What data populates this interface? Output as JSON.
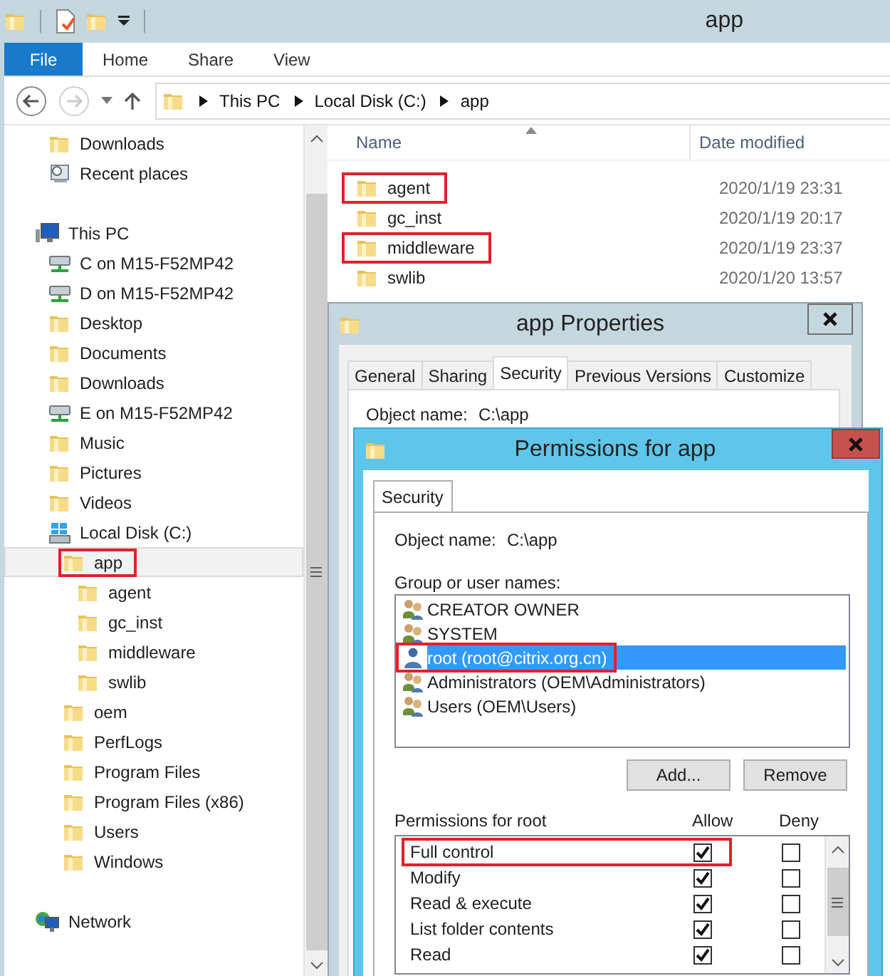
{
  "window": {
    "title": "app"
  },
  "ribbon_tabs": [
    {
      "label": "File",
      "kind": "file"
    },
    {
      "label": "Home",
      "kind": "tab"
    },
    {
      "label": "Share",
      "kind": "tab"
    },
    {
      "label": "View",
      "kind": "tab"
    }
  ],
  "address_bar": {
    "path": [
      "This PC",
      "Local Disk (C:)",
      "app"
    ]
  },
  "sidebar": {
    "items": [
      {
        "children": [
          {
            "label": "Downloads",
            "kind": "folder",
            "selected": false,
            "highlighted": false
          },
          {
            "label": "Recent places",
            "kind": "recent",
            "selected": false,
            "highlighted": false
          }
        ]
      },
      {
        "label": "This PC",
        "kind": "computer",
        "selected": false,
        "highlighted": false,
        "children": [
          {
            "label": "C on M15-F52MP42",
            "kind": "drive",
            "selected": false,
            "highlighted": false
          },
          {
            "label": "D on M15-F52MP42",
            "kind": "drive",
            "selected": false,
            "highlighted": false
          },
          {
            "label": "Desktop",
            "kind": "folder",
            "selected": false,
            "highlighted": false
          },
          {
            "label": "Documents",
            "kind": "folder",
            "selected": false,
            "highlighted": false
          },
          {
            "label": "Downloads",
            "kind": "folder",
            "selected": false,
            "highlighted": false
          },
          {
            "label": "E on M15-F52MP42",
            "kind": "drive",
            "selected": false,
            "highlighted": false
          },
          {
            "label": "Music",
            "kind": "folder",
            "selected": false,
            "highlighted": false
          },
          {
            "label": "Pictures",
            "kind": "folder",
            "selected": false,
            "highlighted": false
          },
          {
            "label": "Videos",
            "kind": "folder",
            "selected": false,
            "highlighted": false
          },
          {
            "label": "Local Disk (C:)",
            "kind": "disk",
            "selected": false,
            "highlighted": false,
            "children": [
              {
                "label": "app",
                "kind": "folder",
                "selected": true,
                "highlighted": true,
                "children": [
                  {
                    "label": "agent",
                    "kind": "folder",
                    "selected": false,
                    "highlighted": false
                  },
                  {
                    "label": "gc_inst",
                    "kind": "folder",
                    "selected": false,
                    "highlighted": false
                  },
                  {
                    "label": "middleware",
                    "kind": "folder",
                    "selected": false,
                    "highlighted": false
                  },
                  {
                    "label": "swlib",
                    "kind": "folder",
                    "selected": false,
                    "highlighted": false
                  }
                ]
              },
              {
                "label": "oem",
                "kind": "folder",
                "selected": false,
                "highlighted": false
              },
              {
                "label": "PerfLogs",
                "kind": "folder",
                "selected": false,
                "highlighted": false
              },
              {
                "label": "Program Files",
                "kind": "folder",
                "selected": false,
                "highlighted": false
              },
              {
                "label": "Program Files (x86)",
                "kind": "folder",
                "selected": false,
                "highlighted": false
              },
              {
                "label": "Users",
                "kind": "folder",
                "selected": false,
                "highlighted": false
              },
              {
                "label": "Windows",
                "kind": "folder",
                "selected": false,
                "highlighted": false
              }
            ]
          }
        ]
      },
      {
        "label": "Network",
        "kind": "network",
        "selected": false,
        "highlighted": false
      }
    ]
  },
  "file_list": {
    "columns": [
      "Name",
      "Date modified"
    ],
    "rows": [
      {
        "name": "agent",
        "date": "2020/1/19 23:31",
        "selected": false,
        "highlighted": true
      },
      {
        "name": "gc_inst",
        "date": "2020/1/19 20:17",
        "selected": false,
        "highlighted": false
      },
      {
        "name": "middleware",
        "date": "2020/1/19 23:37",
        "selected": false,
        "highlighted": true
      },
      {
        "name": "swlib",
        "date": "2020/1/20 13:57",
        "selected": false,
        "highlighted": false
      }
    ]
  },
  "properties_dialog": {
    "title": "app Properties",
    "tabs": [
      {
        "label": "General",
        "selected": false
      },
      {
        "label": "Sharing",
        "selected": false
      },
      {
        "label": "Security",
        "selected": true
      },
      {
        "label": "Previous Versions",
        "selected": false
      },
      {
        "label": "Customize",
        "selected": false
      }
    ],
    "object_name_label": "Object name:",
    "object_name": "C:\\app"
  },
  "permissions_dialog": {
    "title": "Permissions for app",
    "tabs": [
      {
        "label": "Security",
        "selected": true
      }
    ],
    "object_name_label": "Object name:",
    "object_name": "C:\\app",
    "group_label": "Group or user names:",
    "principals": [
      {
        "name": "CREATOR OWNER",
        "kind": "group",
        "selected": false,
        "highlighted": false
      },
      {
        "name": "SYSTEM",
        "kind": "group",
        "selected": false,
        "highlighted": false
      },
      {
        "name": "root (root@citrix.org.cn)",
        "kind": "user",
        "selected": true,
        "highlighted": true
      },
      {
        "name": "Administrators (OEM\\Administrators)",
        "kind": "group",
        "selected": false,
        "highlighted": false
      },
      {
        "name": "Users (OEM\\Users)",
        "kind": "group",
        "selected": false,
        "highlighted": false
      }
    ],
    "buttons": [
      "Add...",
      "Remove"
    ],
    "permissions_label": "Permissions for root",
    "allow_label": "Allow",
    "deny_label": "Deny",
    "permissions": [
      {
        "name": "Full control",
        "allow": true,
        "deny": false,
        "highlighted": true
      },
      {
        "name": "Modify",
        "allow": true,
        "deny": false,
        "highlighted": false
      },
      {
        "name": "Read & execute",
        "allow": true,
        "deny": false,
        "highlighted": false
      },
      {
        "name": "List folder contents",
        "allow": true,
        "deny": false,
        "highlighted": false
      },
      {
        "name": "Read",
        "allow": true,
        "deny": false,
        "highlighted": false
      }
    ]
  }
}
